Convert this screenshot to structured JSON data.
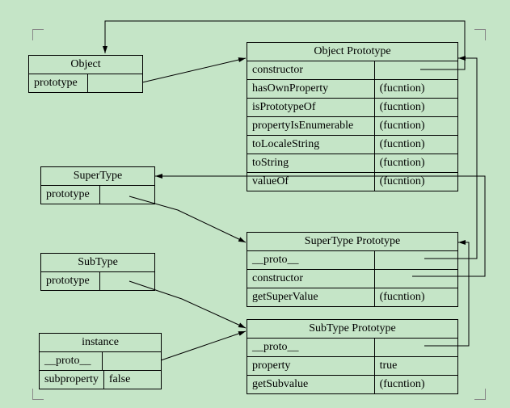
{
  "object_box": {
    "title": "Object",
    "row0_label": "prototype"
  },
  "object_proto": {
    "title": "Object Prototype",
    "rows": [
      {
        "label": "constructor",
        "value": ""
      },
      {
        "label": "hasOwnProperty",
        "value": "(fucntion)"
      },
      {
        "label": "isPrototypeOf",
        "value": "(fucntion)"
      },
      {
        "label": "propertyIsEnumerable",
        "value": "(fucntion)"
      },
      {
        "label": "toLocaleString",
        "value": "(fucntion)"
      },
      {
        "label": "toString",
        "value": "(fucntion)"
      },
      {
        "label": "valueOf",
        "value": "(fucntion)"
      }
    ]
  },
  "supertype_box": {
    "title": "SuperType",
    "row0_label": "prototype"
  },
  "supertype_proto": {
    "title": "SuperType Prototype",
    "rows": [
      {
        "label": "__proto__",
        "value": ""
      },
      {
        "label": "constructor",
        "value": ""
      },
      {
        "label": "getSuperValue",
        "value": "(fucntion)"
      }
    ]
  },
  "subtype_box": {
    "title": "SubType",
    "row0_label": "prototype"
  },
  "subtype_proto": {
    "title": "SubType Prototype",
    "rows": [
      {
        "label": "__proto__",
        "value": ""
      },
      {
        "label": "property",
        "value": "true"
      },
      {
        "label": "getSubvalue",
        "value": "(fucntion)"
      }
    ]
  },
  "instance_box": {
    "title": "instance",
    "rows": [
      {
        "label": "__proto__",
        "value": ""
      },
      {
        "label": "subproperty",
        "value": "false"
      }
    ]
  },
  "chart_data": {
    "type": "diagram",
    "title": "JavaScript prototype chain",
    "nodes": [
      {
        "id": "Object",
        "fields": [
          {
            "name": "prototype"
          }
        ]
      },
      {
        "id": "ObjectPrototype",
        "fields": [
          {
            "name": "constructor"
          },
          {
            "name": "hasOwnProperty",
            "value": "(fucntion)"
          },
          {
            "name": "isPrototypeOf",
            "value": "(fucntion)"
          },
          {
            "name": "propertyIsEnumerable",
            "value": "(fucntion)"
          },
          {
            "name": "toLocaleString",
            "value": "(fucntion)"
          },
          {
            "name": "toString",
            "value": "(fucntion)"
          },
          {
            "name": "valueOf",
            "value": "(fucntion)"
          }
        ]
      },
      {
        "id": "SuperType",
        "fields": [
          {
            "name": "prototype"
          }
        ]
      },
      {
        "id": "SuperTypePrototype",
        "fields": [
          {
            "name": "__proto__"
          },
          {
            "name": "constructor"
          },
          {
            "name": "getSuperValue",
            "value": "(fucntion)"
          }
        ]
      },
      {
        "id": "SubType",
        "fields": [
          {
            "name": "prototype"
          }
        ]
      },
      {
        "id": "SubTypePrototype",
        "fields": [
          {
            "name": "__proto__"
          },
          {
            "name": "property",
            "value": "true"
          },
          {
            "name": "getSubvalue",
            "value": "(fucntion)"
          }
        ]
      },
      {
        "id": "instance",
        "fields": [
          {
            "name": "__proto__"
          },
          {
            "name": "subproperty",
            "value": "false"
          }
        ]
      }
    ],
    "edges": [
      {
        "from": "Object.prototype",
        "to": "ObjectPrototype"
      },
      {
        "from": "ObjectPrototype.constructor",
        "to": "Object"
      },
      {
        "from": "SuperType.prototype",
        "to": "SuperTypePrototype"
      },
      {
        "from": "SuperTypePrototype.__proto__",
        "to": "ObjectPrototype"
      },
      {
        "from": "SuperTypePrototype.constructor",
        "to": "SuperType"
      },
      {
        "from": "SubType.prototype",
        "to": "SubTypePrototype"
      },
      {
        "from": "SubTypePrototype.__proto__",
        "to": "SuperTypePrototype"
      },
      {
        "from": "instance.__proto__",
        "to": "SubTypePrototype"
      }
    ]
  }
}
